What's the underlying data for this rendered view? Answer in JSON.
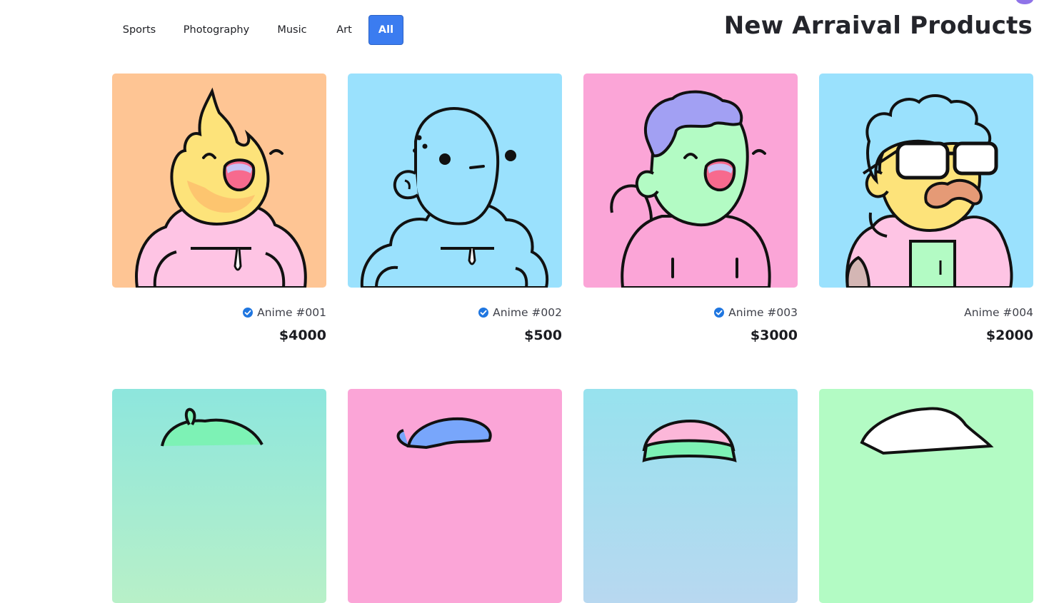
{
  "filters": {
    "items": [
      {
        "label": "Sports"
      },
      {
        "label": "Photography"
      },
      {
        "label": "Music"
      },
      {
        "label": "Art"
      },
      {
        "label": "All",
        "active": true
      }
    ]
  },
  "page_title": "New Arraival Products",
  "products": [
    {
      "name": "Anime #001",
      "price": "$4000",
      "verified": true,
      "bg": "#fec594",
      "avatar": "flame-character"
    },
    {
      "name": "Anime #002",
      "price": "$500",
      "verified": true,
      "bg": "#9ae1fd",
      "avatar": "blue-bald-character"
    },
    {
      "name": "Anime #003",
      "price": "$3000",
      "verified": true,
      "bg": "#fba5d7",
      "avatar": "green-hoodie-character"
    },
    {
      "name": "Anime #004",
      "price": "$2000",
      "verified": false,
      "bg": "#9ae1fd",
      "avatar": "glasses-mustache-character"
    }
  ],
  "products_row2": [
    {
      "bg": "#8de6dd",
      "avatar": "green-sprout-character"
    },
    {
      "bg": "#fba5d7",
      "avatar": "blue-cap-character"
    },
    {
      "bg": "#97dfee",
      "avatar": "pink-beanie-character"
    },
    {
      "bg": "#b3fbc4",
      "avatar": "white-hat-character"
    }
  ],
  "colors": {
    "accent": "#3b7cf0",
    "verified": "#1f76e0",
    "outline": "#111111"
  }
}
